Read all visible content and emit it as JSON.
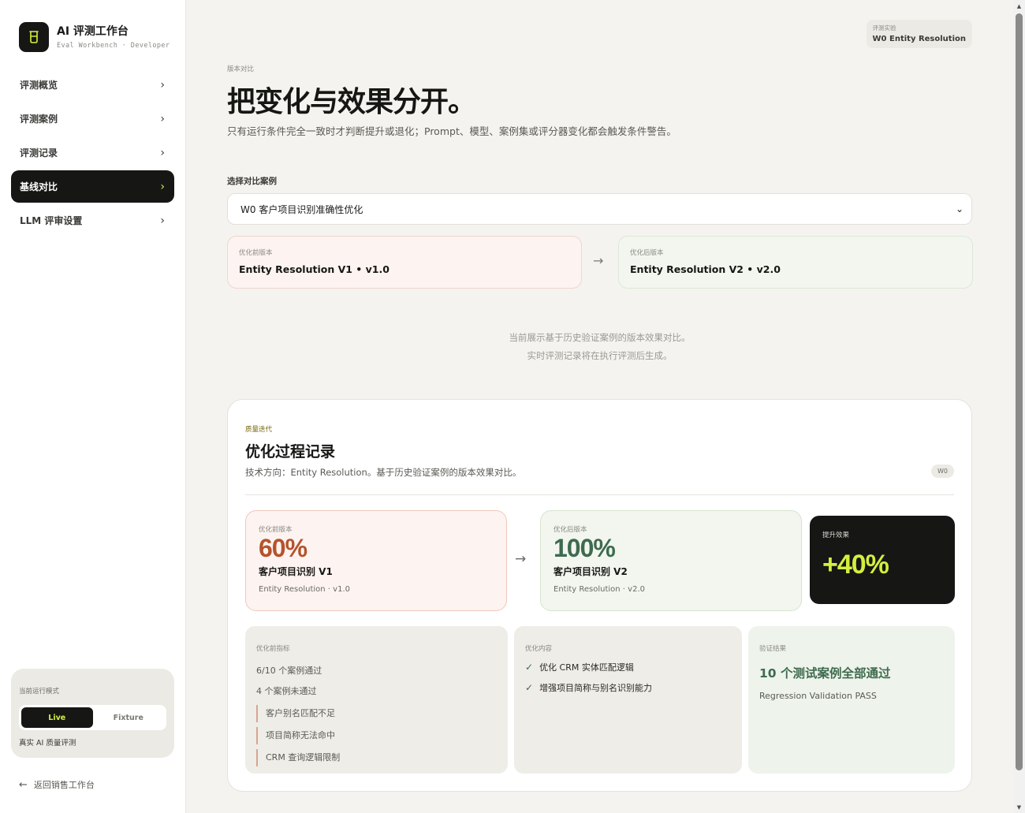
{
  "app": {
    "title": "AI 评测工作台",
    "subtitle": "Eval Workbench · Developer"
  },
  "sidebar": {
    "items": [
      {
        "label": "评测概览",
        "active": false
      },
      {
        "label": "评测案例",
        "active": false
      },
      {
        "label": "评测记录",
        "active": false
      },
      {
        "label": "基线对比",
        "active": true
      },
      {
        "label": "LLM 评审设置",
        "active": false
      }
    ],
    "mode": {
      "caption": "当前运行模式",
      "live_label": "Live",
      "fixture_label": "Fixture",
      "selected": "Live",
      "description": "真实 AI 质量评测"
    },
    "back_label": "返回销售工作台"
  },
  "header": {
    "experiment_caption": "评测实验",
    "experiment_value": "W0 Entity Resolution",
    "eyebrow": "版本对比",
    "title": "把变化与效果分开。",
    "subtitle": "只有运行条件完全一致时才判断提升或退化；Prompt、模型、案例集或评分器变化都会触发条件警告。"
  },
  "selector": {
    "label": "选择对比案例",
    "value": "W0 客户项目识别准确性优化"
  },
  "versions": {
    "before_caption": "优化前版本",
    "before_value": "Entity Resolution V1 • v1.0",
    "after_caption": "优化后版本",
    "after_value": "Entity Resolution V2 • v2.0"
  },
  "notes": {
    "line1": "当前展示基于历史验证案例的版本效果对比。",
    "line2": "实时评测记录将在执行评测后生成。"
  },
  "panel": {
    "eyebrow": "质量迭代",
    "title": "优化过程记录",
    "description": "技术方向：Entity Resolution。基于历史验证案例的版本效果对比。",
    "tag": "W0",
    "before": {
      "caption": "优化前版本",
      "percent": "60%",
      "name": "客户项目识别 V1",
      "version": "Entity Resolution · v1.0"
    },
    "after": {
      "caption": "优化后版本",
      "percent": "100%",
      "name": "客户项目识别 V2",
      "version": "Entity Resolution · v2.0"
    },
    "effect": {
      "caption": "提升效果",
      "value": "+40%"
    },
    "metrics": {
      "caption": "优化前指标",
      "passed": "6/10 个案例通过",
      "failed": "4 个案例未通过",
      "issues": [
        "客户别名匹配不足",
        "项目简称无法命中",
        "CRM 查询逻辑限制"
      ]
    },
    "changes": {
      "caption": "优化内容",
      "items": [
        "优化 CRM 实体匹配逻辑",
        "增强项目简称与别名识别能力"
      ]
    },
    "result": {
      "caption": "验证结果",
      "title": "10 个测试案例全部通过",
      "subtitle": "Regression Validation PASS"
    }
  },
  "colors": {
    "dark": "#161714",
    "accent": "#d4ef3e",
    "before_accent": "#b4532c",
    "after_accent": "#3e6b4e"
  },
  "icons": {
    "brand": "beaker-icon",
    "nav": "chevron-right-icon",
    "back": "arrow-left-icon",
    "compare": "arrow-right-icon",
    "check": "check-icon"
  }
}
